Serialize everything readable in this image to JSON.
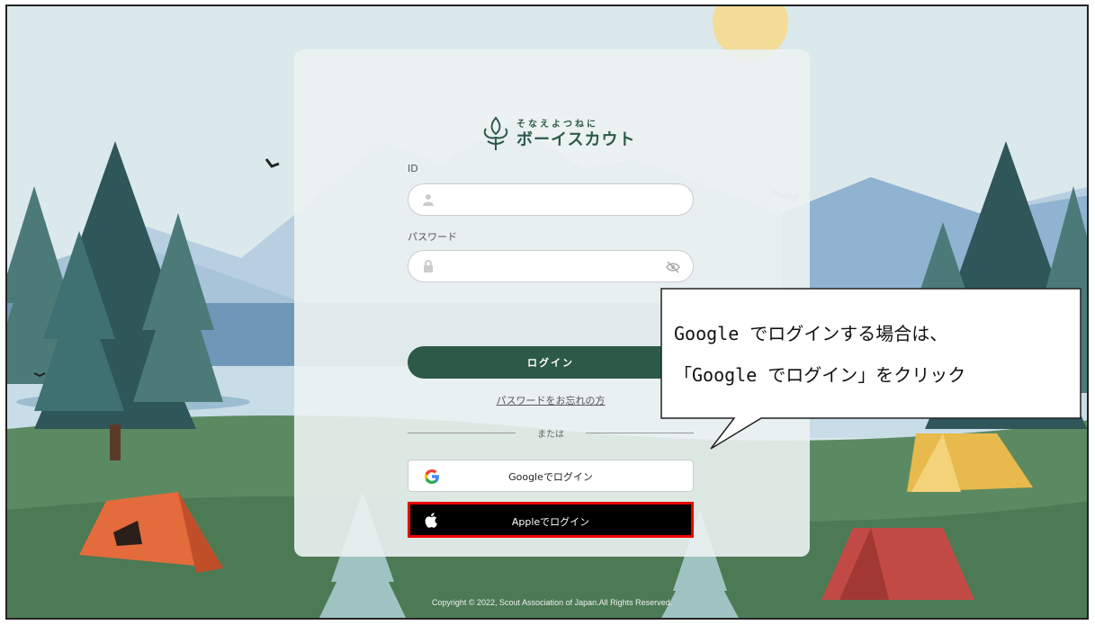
{
  "brand": {
    "tagline": "そなえよつねに",
    "name": "ボーイスカウト"
  },
  "form": {
    "id_label": "ID",
    "password_label": "パスワード",
    "login_button": "ログイン",
    "forgot_password": "パスワードをお忘れの方",
    "divider_text": "または",
    "google_button": "Googleでログイン",
    "apple_button": "Appleでログイン"
  },
  "footer": {
    "copyright": "Copyright © 2022, Scout Association of Japan.All Rights Reserved."
  },
  "annotation": {
    "line1": "Google でログインする場合は、",
    "line2": "「Google でログイン」をクリック",
    "highlight_color": "#e00000"
  },
  "colors": {
    "primary": "#2d5a47",
    "sky": "#dbe9ec",
    "grass": "#5b8a62"
  },
  "icons": [
    "user-icon",
    "lock-icon",
    "eye-off-icon",
    "google-icon",
    "apple-icon",
    "scout-emblem-icon"
  ]
}
